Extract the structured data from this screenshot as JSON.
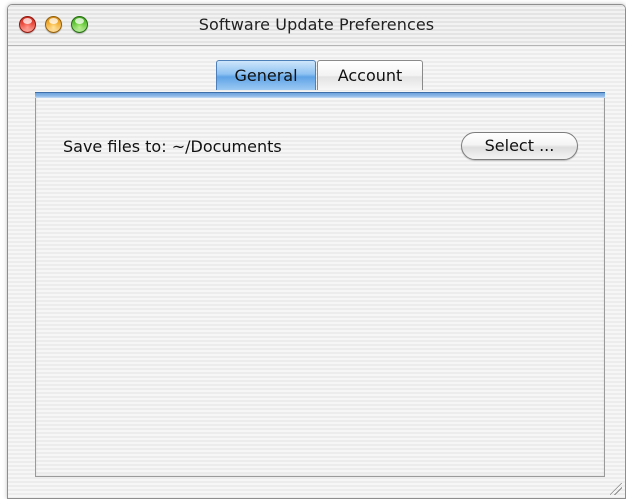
{
  "window": {
    "title": "Software Update Preferences",
    "controls": [
      "close-button",
      "minimize-button",
      "zoom-button"
    ]
  },
  "tabs": [
    {
      "label": "General",
      "selected": true
    },
    {
      "label": "Account",
      "selected": false
    }
  ],
  "general": {
    "save_files_label": "Save files to:",
    "save_files_path": "~/Documents",
    "select_button_label": "Select ..."
  },
  "colors": {
    "selected_tab": "#5fa3e6",
    "close": "#e8392a",
    "minimize": "#f2a520",
    "zoom": "#55c12a"
  }
}
